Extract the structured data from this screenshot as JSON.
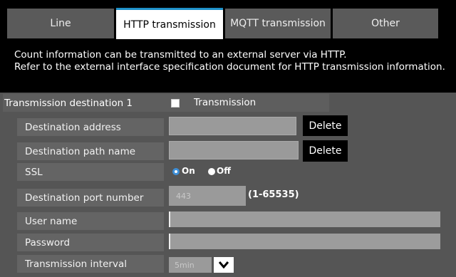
{
  "tabs": [
    {
      "label": "Line",
      "active": false
    },
    {
      "label": "HTTP transmission",
      "active": true
    },
    {
      "label": "MQTT transmission",
      "active": false
    },
    {
      "label": "Other",
      "active": false
    }
  ],
  "description": {
    "line1": "Count information can be transmitted to an external server via HTTP.",
    "line2": "Refer to the external interface specification document for HTTP transmission information."
  },
  "section": {
    "title": "Transmission destination 1",
    "checkbox_label": "Transmission",
    "checkbox_checked": false
  },
  "fields": {
    "destination_address": {
      "label": "Destination address",
      "value": "",
      "delete_label": "Delete"
    },
    "destination_path": {
      "label": "Destination path name",
      "value": "",
      "delete_label": "Delete"
    },
    "ssl": {
      "label": "SSL",
      "on_label": "On",
      "off_label": "Off",
      "selected": "On"
    },
    "port": {
      "label": "Destination port number",
      "value": "443",
      "range": "(1-65535)"
    },
    "user_name": {
      "label": "User name",
      "value": ""
    },
    "password": {
      "label": "Password",
      "value": ""
    },
    "interval": {
      "label": "Transmission interval",
      "value": "5min"
    }
  },
  "colors": {
    "active_tab_accent": "#1e90c8",
    "radio_selected": "#3d8fd8"
  }
}
